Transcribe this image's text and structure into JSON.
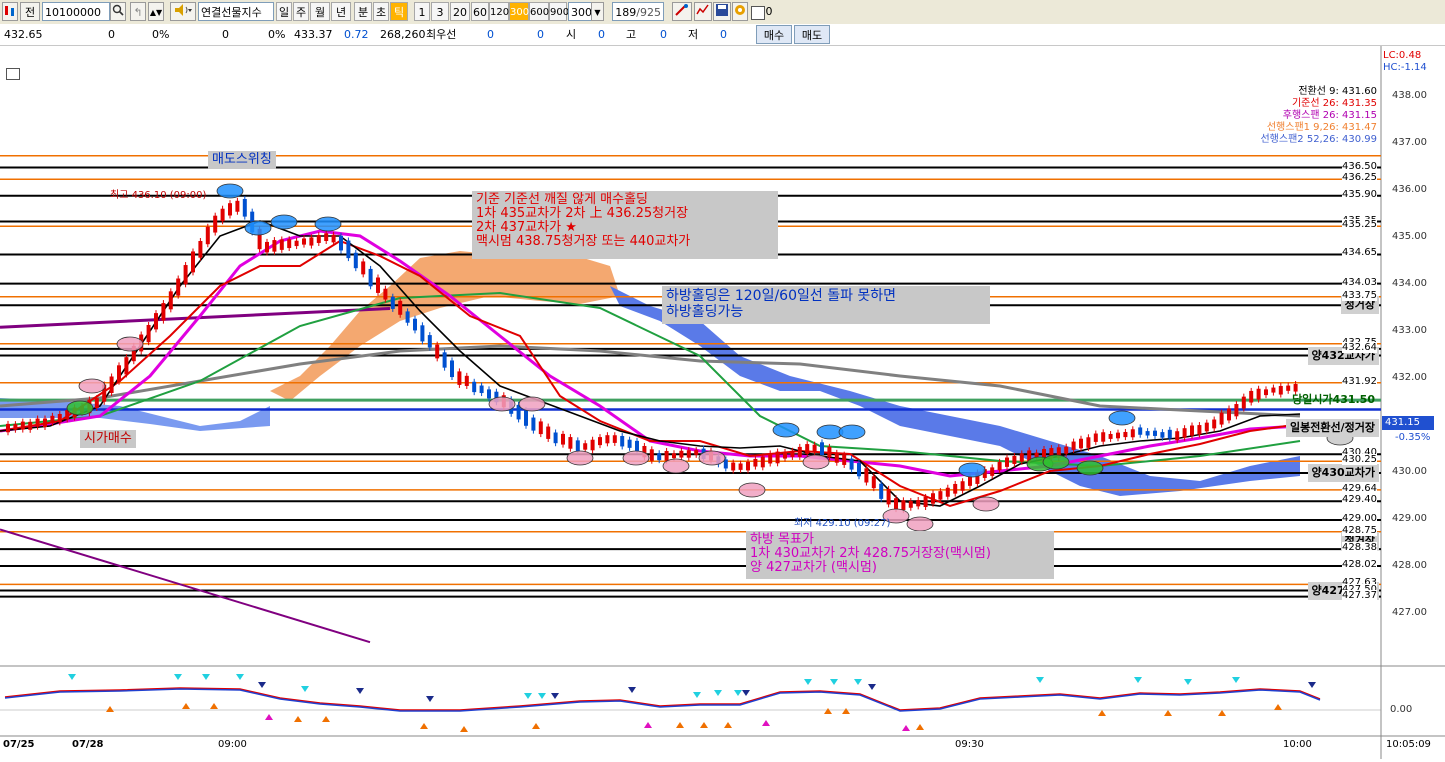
{
  "toolbar": {
    "mode_label": "전",
    "code_value": "10100000",
    "name_value": "연결선물지수",
    "period_tabs": [
      "일",
      "주",
      "월",
      "년",
      "분",
      "초",
      "틱"
    ],
    "tick_periods": [
      "1",
      "3",
      "20",
      "60",
      "120",
      "300",
      "600",
      "900"
    ],
    "active_period": "300",
    "count_value": "300",
    "page_value": "189",
    "page_total": "/925",
    "checkbox_label": "0"
  },
  "quote": {
    "current": "432.65",
    "v1": "0",
    "p1": "0%",
    "v2": "0",
    "p2": "0%",
    "price2": "433.37",
    "change": "0.72",
    "volume": "268,260",
    "best_label": "최우선",
    "best1": "0",
    "best2": "0",
    "open_label": "시",
    "open_val": "0",
    "high_label": "고",
    "high_val": "0",
    "low_label": "저",
    "low_val": "0",
    "buy_label": "매수",
    "sell_label": "매도"
  },
  "legend": {
    "lc": "LC:0.48",
    "hc": "HC:-1.14",
    "items": [
      {
        "text": "전환선 9: 431.60",
        "color": "#000000"
      },
      {
        "text": "기준선 26: 431.35",
        "color": "#e00000"
      },
      {
        "text": "후행스팬 26: 431.15",
        "color": "#b000b0"
      },
      {
        "text": "선행스팬1 9,26: 431.47",
        "color": "#f08030"
      },
      {
        "text": "선행스팬2 52,26: 430.99",
        "color": "#4060d0"
      }
    ]
  },
  "annotations": {
    "sell_switch": "매도스위칭",
    "high_mark": "최고 436.10 (09:00)",
    "low_mark": "최저 429.10 (09:27)",
    "open_buy": "시가매수",
    "panel1": [
      "기준  기준선  깨질  않게  매수홀딩",
      "1차  435교차가   2차 上 436.25청거장",
      "2차  437교차가  ★",
      "맥시멈  438.75청거장  또는  440교차가"
    ],
    "panel2": [
      "하방홀딩은   120일/60일선  돌파  못하면",
      "하방홀딩가능"
    ],
    "panel3": [
      "하방  목표가",
      "1차  430교차가  2차  428.75거장장(맥시멈)",
      "양  427교차가  (맥시멈)"
    ]
  },
  "right_tags": [
    {
      "text": "청거장",
      "price": 433.57
    },
    {
      "text": "양432교차가",
      "price": 432.5
    },
    {
      "text": "당일시가431.50",
      "price": 431.55
    },
    {
      "text": "일봉전환선/정거장",
      "price": 430.95
    },
    {
      "text": "양430교차가",
      "price": 430.0
    },
    {
      "text": "청거장",
      "price": 428.55
    },
    {
      "text": "양427교차가",
      "price": 427.5
    }
  ],
  "price_axis": {
    "ticks": [
      "438.00",
      "437.00",
      "436.00",
      "435.00",
      "434.00",
      "433.00",
      "432.00",
      "431.00",
      "430.00",
      "429.00",
      "428.00",
      "427.00"
    ],
    "current_price": "431.15",
    "current_change": "-0.35%",
    "level_labels": [
      "436.50",
      "436.25",
      "435.90",
      "435.35",
      "435.25",
      "434.65",
      "434.03",
      "433.75",
      "432.75",
      "432.64",
      "431.92",
      "430.40",
      "430.25",
      "429.64",
      "429.40",
      "429.00",
      "428.75",
      "428.38",
      "428.02",
      "427.63",
      "427.50",
      "427.37"
    ],
    "osc_zero": "0.00"
  },
  "time_axis": {
    "labels": [
      "07/25",
      "07/28",
      "09:00",
      "09:30",
      "10:00"
    ],
    "clock": "10:05:09"
  },
  "colors": {
    "toolbar_bg": "#ece9d8",
    "up_candle": "#e00000",
    "down_candle": "#0050d0",
    "cloud_orange": "#f0a060",
    "cloud_blue": "#5070e0"
  }
}
